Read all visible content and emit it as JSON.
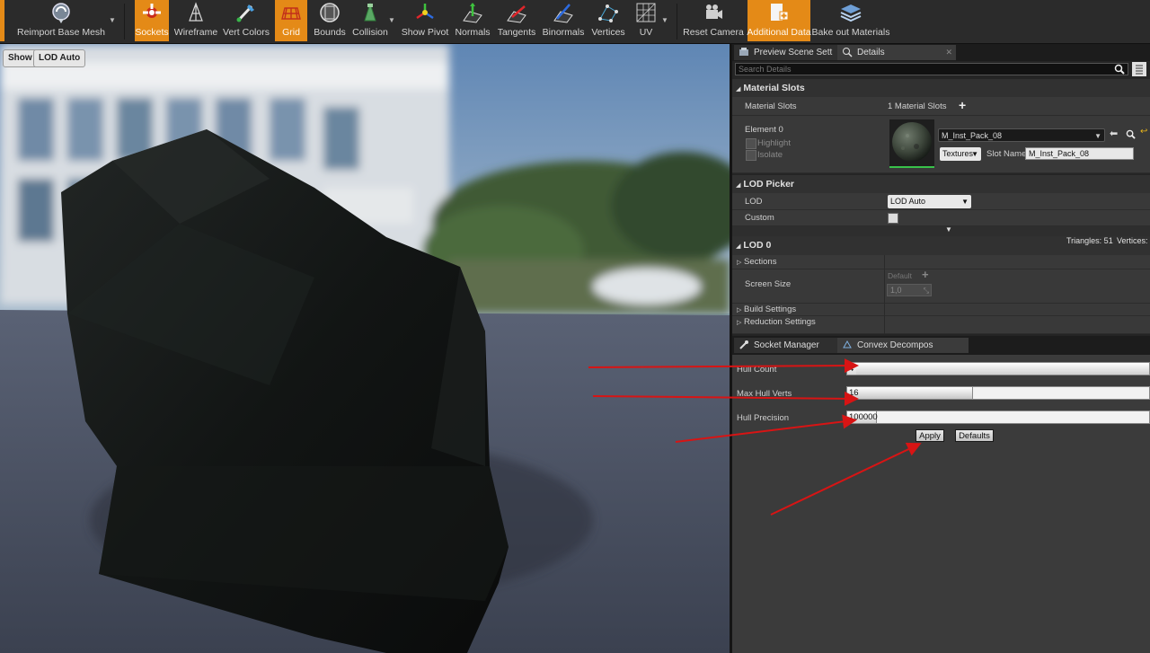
{
  "toolbar": {
    "items": [
      {
        "label": "Reimport Base Mesh",
        "icon": "reimport-icon"
      },
      {
        "label": "Sockets",
        "icon": "sockets-icon",
        "active": true
      },
      {
        "label": "Wireframe",
        "icon": "wireframe-icon"
      },
      {
        "label": "Vert Colors",
        "icon": "vert-colors-icon"
      },
      {
        "label": "Grid",
        "icon": "grid-icon",
        "active": true
      },
      {
        "label": "Bounds",
        "icon": "bounds-icon"
      },
      {
        "label": "Collision",
        "icon": "collision-icon"
      },
      {
        "label": "Show Pivot",
        "icon": "pivot-icon"
      },
      {
        "label": "Normals",
        "icon": "normals-icon"
      },
      {
        "label": "Tangents",
        "icon": "tangents-icon"
      },
      {
        "label": "Binormals",
        "icon": "binormals-icon"
      },
      {
        "label": "Vertices",
        "icon": "vertices-icon"
      },
      {
        "label": "UV",
        "icon": "uv-icon"
      },
      {
        "label": "Reset Camera",
        "icon": "camera-icon"
      },
      {
        "label": "Additional Data",
        "icon": "additional-data-icon",
        "active": true
      },
      {
        "label": "Bake out Materials",
        "icon": "bake-icon"
      }
    ]
  },
  "viewport": {
    "show_button": "Show",
    "lod_button": "LOD Auto"
  },
  "details_tabs": {
    "preview": "Preview Scene Sett",
    "details": "Details"
  },
  "search": {
    "placeholder": "Search Details"
  },
  "material_slots": {
    "header": "Material Slots",
    "label": "Material Slots",
    "count_text": "1 Material Slots",
    "element_label": "Element 0",
    "highlight": "Highlight",
    "isolate": "Isolate",
    "material_name": "M_Inst_Pack_08",
    "textures_label": "Textures",
    "slot_name_label": "Slot Name",
    "slot_name_value": "M_Inst_Pack_08"
  },
  "lod_picker": {
    "header": "LOD Picker",
    "lod_label": "LOD",
    "lod_value": "LOD Auto",
    "custom_label": "Custom"
  },
  "lod0": {
    "header": "LOD 0",
    "triangles": "Triangles: 51",
    "vertices": "Vertices:",
    "sections": "Sections",
    "screen_size_label": "Screen Size",
    "default_label": "Default",
    "screen_size_value": "1,0",
    "build_settings": "Build Settings",
    "reduction_settings": "Reduction Settings"
  },
  "bottom_tabs": {
    "socket_manager": "Socket Manager",
    "convex": "Convex Decompos"
  },
  "convex": {
    "hull_count_label": "Hull Count",
    "hull_count_value": "4",
    "max_hull_verts_label": "Max Hull Verts",
    "max_hull_verts_value": "16",
    "hull_precision_label": "Hull Precision",
    "hull_precision_value": "100000",
    "apply": "Apply",
    "defaults": "Defaults"
  },
  "colors": {
    "active": "#e48a17",
    "annotation": "#d81414"
  }
}
